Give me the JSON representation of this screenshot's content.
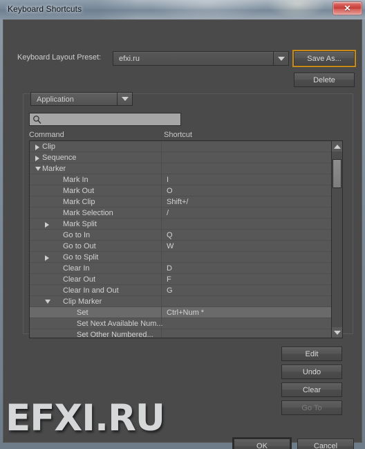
{
  "window": {
    "title": "Keyboard Shortcuts",
    "close_label": "✕"
  },
  "preset": {
    "label": "Keyboard Layout Preset:",
    "value": "efxi.ru",
    "save_as_label": "Save As...",
    "delete_label": "Delete"
  },
  "scope": {
    "value": "Application"
  },
  "search": {
    "value": "",
    "placeholder": "",
    "icon": "search-icon"
  },
  "columns": {
    "command": "Command",
    "shortcut": "Shortcut"
  },
  "rows": [
    {
      "label": "Clip",
      "shortcut": "",
      "indent": 0,
      "twisty": "closed",
      "selected": false
    },
    {
      "label": "Sequence",
      "shortcut": "",
      "indent": 0,
      "twisty": "closed",
      "selected": false
    },
    {
      "label": "Marker",
      "shortcut": "",
      "indent": 0,
      "twisty": "open",
      "selected": false
    },
    {
      "label": "Mark In",
      "shortcut": "I",
      "indent": 1,
      "twisty": "none",
      "selected": false
    },
    {
      "label": "Mark Out",
      "shortcut": "O",
      "indent": 1,
      "twisty": "none",
      "selected": false
    },
    {
      "label": "Mark Clip",
      "shortcut": "Shift+/",
      "indent": 1,
      "twisty": "none",
      "selected": false
    },
    {
      "label": "Mark Selection",
      "shortcut": "/",
      "indent": 1,
      "twisty": "none",
      "selected": false
    },
    {
      "label": "Mark Split",
      "shortcut": "",
      "indent": 1,
      "twisty": "closed",
      "selected": false
    },
    {
      "label": "Go to In",
      "shortcut": "Q",
      "indent": 1,
      "twisty": "none",
      "selected": false
    },
    {
      "label": "Go to Out",
      "shortcut": "W",
      "indent": 1,
      "twisty": "none",
      "selected": false
    },
    {
      "label": "Go to Split",
      "shortcut": "",
      "indent": 1,
      "twisty": "closed",
      "selected": false
    },
    {
      "label": "Clear In",
      "shortcut": "D",
      "indent": 1,
      "twisty": "none",
      "selected": false
    },
    {
      "label": "Clear Out",
      "shortcut": "F",
      "indent": 1,
      "twisty": "none",
      "selected": false
    },
    {
      "label": "Clear In and Out",
      "shortcut": "G",
      "indent": 1,
      "twisty": "none",
      "selected": false
    },
    {
      "label": "Clip Marker",
      "shortcut": "",
      "indent": 1,
      "twisty": "open",
      "selected": false
    },
    {
      "label": "Set",
      "shortcut": "Ctrl+Num *",
      "indent": 2,
      "twisty": "none",
      "selected": true
    },
    {
      "label": "Set Next Available Num...",
      "shortcut": "",
      "indent": 2,
      "twisty": "none",
      "selected": false
    },
    {
      "label": "Set Other Numbered...",
      "shortcut": "",
      "indent": 2,
      "twisty": "none",
      "selected": false
    }
  ],
  "side_buttons": {
    "edit": "Edit",
    "undo": "Undo",
    "clear": "Clear",
    "go_to": "Go To"
  },
  "footer": {
    "ok": "OK",
    "cancel": "Cancel"
  },
  "watermark": {
    "text": "EFXI.RU"
  },
  "colors": {
    "dialog_bg": "#4a4a4a",
    "row_bg": "#575757",
    "row_selected": "#6a6a6a",
    "focus_outline": "#c98b15",
    "close_red": "#c23b36",
    "text": "#d2d2d2"
  }
}
